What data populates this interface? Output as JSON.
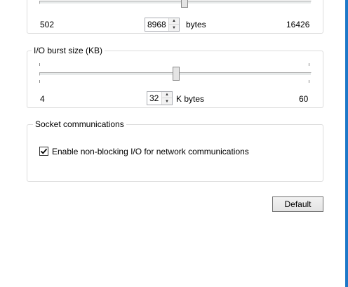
{
  "buffer_slider": {
    "min": "502",
    "max": "16426",
    "value": "8968",
    "unit": "bytes",
    "level_fraction": 0.53
  },
  "io_burst": {
    "label": "I/O burst size (KB)",
    "min": "4",
    "max": "60",
    "value": "32",
    "unit": "K bytes",
    "level_fraction": 0.5
  },
  "socket": {
    "label": "Socket communications",
    "nonblocking_label": "Enable non-blocking I/O for network communications",
    "nonblocking_checked": true
  },
  "default_label": "Default",
  "icons": {
    "spin_up": "spin-up-arrow-icon",
    "spin_down": "spin-down-arrow-icon",
    "check": "checkmark-icon"
  },
  "colors": {
    "frame_accent": "#1e78c8",
    "group_border": "#dcdcdc"
  }
}
